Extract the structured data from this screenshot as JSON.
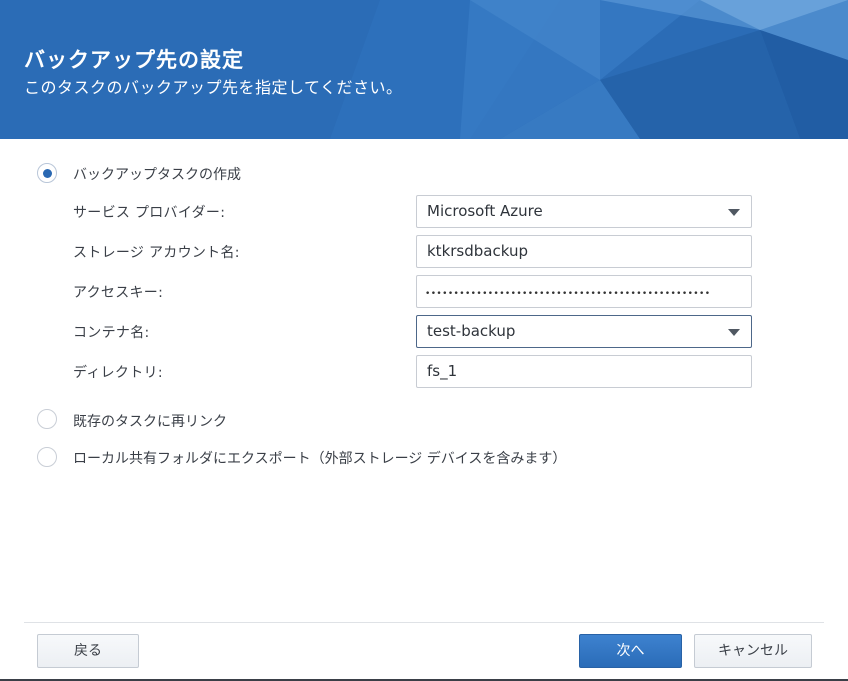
{
  "header": {
    "title": "バックアップ先の設定",
    "subtitle": "このタスクのバックアップ先を指定してください。"
  },
  "options": [
    {
      "label": "バックアップタスクの作成",
      "checked": true
    },
    {
      "label": "既存のタスクに再リンク",
      "checked": false
    },
    {
      "label": "ローカル共有フォルダにエクスポート（外部ストレージ デバイスを含みます）",
      "checked": false
    }
  ],
  "form": {
    "provider": {
      "label": "サービス プロバイダー:",
      "value": "Microsoft Azure"
    },
    "account": {
      "label": "ストレージ アカウント名:",
      "value": "ktkrsdbackup"
    },
    "key": {
      "label": "アクセスキー:",
      "value": "••••••••••••••••••••••••••••••••••••••••••••••••••"
    },
    "container": {
      "label": "コンテナ名:",
      "value": "test-backup"
    },
    "directory": {
      "label": "ディレクトリ:",
      "value": "fs_1"
    }
  },
  "buttons": {
    "back": "戻る",
    "next": "次へ",
    "cancel": "キャンセル"
  },
  "colors": {
    "header_blue": "#2a6cb8",
    "primary_button": "#3477c4",
    "radio_checked": "#2a68b2"
  }
}
